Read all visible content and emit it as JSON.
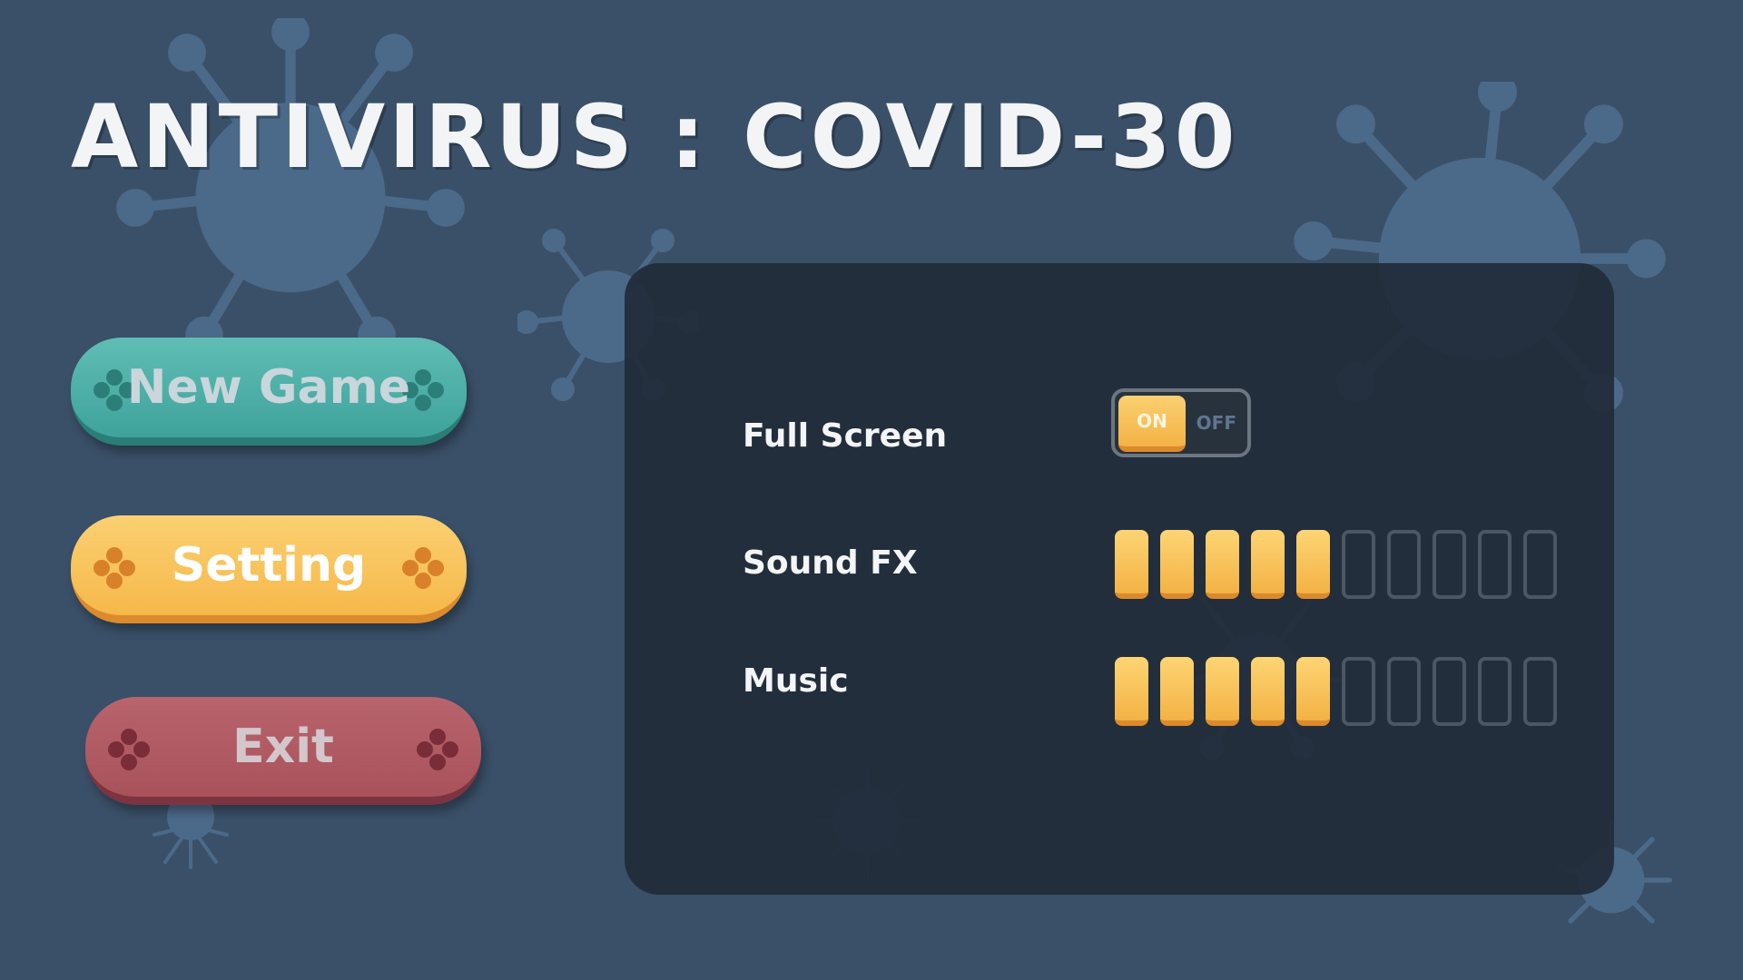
{
  "title": "ANTIVIRUS : COVID-30",
  "menu": {
    "new_game": "New Game",
    "setting": "Setting",
    "exit": "Exit"
  },
  "settings": {
    "fullscreen": {
      "label": "Full Screen",
      "on_label": "ON",
      "off_label": "OFF",
      "value": "ON"
    },
    "sound_fx": {
      "label": "Sound FX",
      "level": 5,
      "max": 10
    },
    "music": {
      "label": "Music",
      "level": 5,
      "max": 10
    }
  },
  "colors": {
    "background": "#3a5068",
    "panel": "#212b38",
    "new_game": "#4fb0a8",
    "setting": "#f8c45e",
    "exit": "#ae5a63",
    "accent": "#f5b84a"
  },
  "icons": [
    "virus-icon",
    "gamepad-icon"
  ]
}
